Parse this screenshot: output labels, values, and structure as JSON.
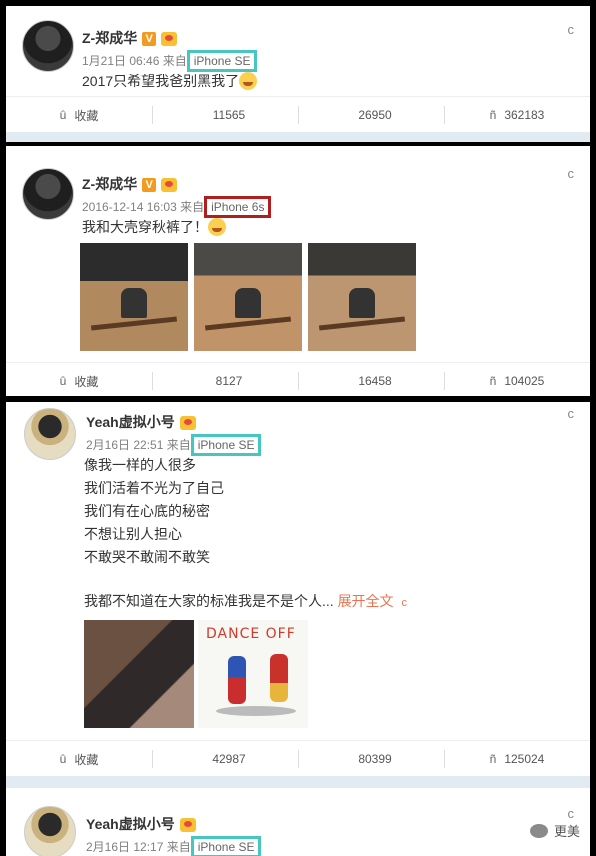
{
  "posts": [
    {
      "user": "Z-郑成华",
      "verified": "V",
      "time": "1月21日 06:46",
      "from_label": "来自",
      "source": "iPhone SE",
      "text": "2017只希望我爸别黑我了",
      "actions": {
        "fav": "收藏",
        "repost": "11565",
        "comment": "26950",
        "like": "362183"
      }
    },
    {
      "user": "Z-郑成华",
      "verified": "V",
      "time": "2016-12-14 16:03",
      "from_label": "来自",
      "source": "iPhone 6s",
      "text": "我和大壳穿秋裤了！",
      "actions": {
        "fav": "收藏",
        "repost": "8127",
        "comment": "16458",
        "like": "104025"
      }
    },
    {
      "user": "Yeah虚拟小号",
      "time": "2月16日 22:51",
      "from_label": "来自",
      "source": "iPhone SE",
      "lines": [
        "像我一样的人很多",
        "我们活着不光为了自己",
        "我们有在心底的秘密",
        "不想让别人担心",
        "不敢哭不敢闹不敢笑"
      ],
      "last_line": "我都不知道在大家的标准我是不是个人...",
      "expand": "展开全文",
      "expand_icon": "c",
      "image_text": "DANCE OFF",
      "actions": {
        "fav": "收藏",
        "repost": "42987",
        "comment": "80399",
        "like": "125024"
      }
    },
    {
      "user": "Yeah虚拟小号",
      "time": "2月16日 12:17",
      "from_label": "来自",
      "source": "iPhone SE"
    }
  ],
  "icons": {
    "chevron": "c",
    "fav": "û",
    "repost": "",
    "comment": "",
    "like": "ñ"
  },
  "watermark": "更美",
  "colors": {
    "highlight_teal": "#45c6c1",
    "highlight_red": "#b01e1e",
    "expand_link": "#eb7350"
  }
}
